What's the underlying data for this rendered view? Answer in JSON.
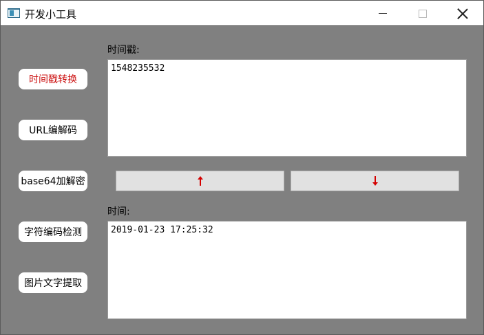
{
  "window": {
    "title": "开发小工具",
    "icon": "app-window-icon"
  },
  "sidebar": {
    "items": [
      {
        "label": "时间戳转换",
        "active": true
      },
      {
        "label": "URL编解码",
        "active": false
      },
      {
        "label": "base64加解密",
        "active": false
      },
      {
        "label": "字符编码检测",
        "active": false
      },
      {
        "label": "图片文字提取",
        "active": false
      }
    ]
  },
  "timestamp": {
    "label": "时间戳:",
    "value": "1548235532"
  },
  "datetime": {
    "label": "时间:",
    "value": "2019-01-23 17:25:32"
  },
  "actions": {
    "to_timestamp_icon": "arrow-up-icon",
    "to_datetime_icon": "arrow-down-icon"
  },
  "colors": {
    "accent": "#cc1111",
    "panel_bg": "#808080",
    "arrow": "#d40000"
  }
}
